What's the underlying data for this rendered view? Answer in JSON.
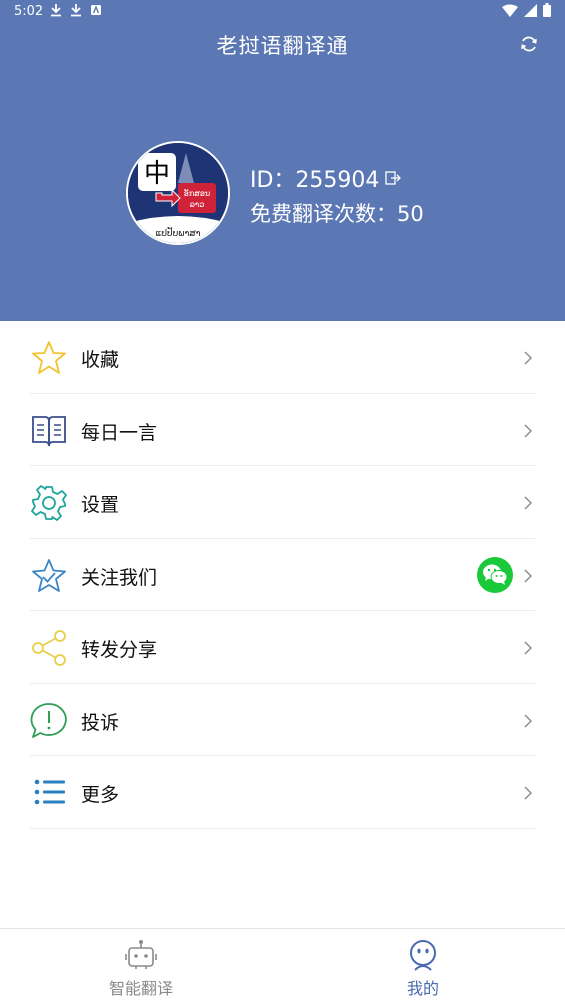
{
  "status_bar": {
    "time": "5:02"
  },
  "header": {
    "title": "老挝语翻译通",
    "user_id": "ID：255904",
    "free_translations": "免费翻译次数：50",
    "avatar": {
      "char": "中",
      "lao_top": "ອັກສອນ",
      "lao_bottom": "ລາວ",
      "lao_band": "ແປປັບພາສາ"
    }
  },
  "menu": {
    "items": [
      {
        "label": "收藏",
        "icon": "star-icon",
        "color": "#f2c230"
      },
      {
        "label": "每日一言",
        "icon": "book-icon",
        "color": "#3b4f8f"
      },
      {
        "label": "设置",
        "icon": "gear-icon",
        "color": "#1fa59a"
      },
      {
        "label": "关注我们",
        "icon": "star-badge-icon",
        "color": "#3b86c6"
      },
      {
        "label": "转发分享",
        "icon": "share-icon",
        "color": "#e7cf4b"
      },
      {
        "label": "投诉",
        "icon": "complaint-icon",
        "color": "#2f9f55"
      },
      {
        "label": "更多",
        "icon": "list-icon",
        "color": "#2a7fc0"
      }
    ]
  },
  "bottom_nav": {
    "tabs": [
      {
        "label": "智能翻译",
        "icon": "robot-icon",
        "active": false
      },
      {
        "label": "我的",
        "icon": "user-face-icon",
        "active": true
      }
    ]
  },
  "colors": {
    "header_bg": "#5b78b4",
    "active_tab": "#4a6aae",
    "wechat": "#19c93a"
  }
}
